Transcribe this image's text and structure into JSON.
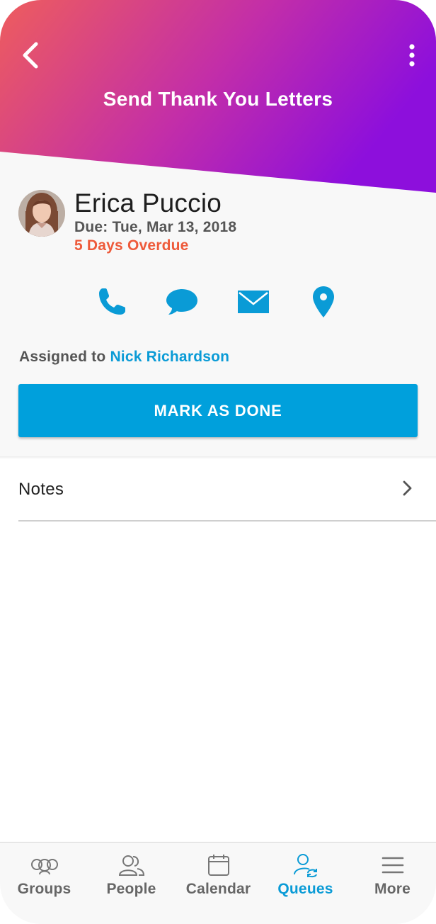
{
  "colors": {
    "gradient_start": "#ee5d5d",
    "gradient_mid": "#c32ea8",
    "gradient_end": "#8d0fdc",
    "accent": "#00a0dc",
    "overdue": "#ee5a3a",
    "icon_blue": "#0a9bd6"
  },
  "header": {
    "title": "Send Thank You Letters",
    "back_icon": "chevron-left-icon",
    "menu_icon": "kebab-menu-icon"
  },
  "person": {
    "name": "Erica Puccio",
    "due": "Due: Tue, Mar 13, 2018",
    "overdue": "5 Days Overdue"
  },
  "actions": [
    {
      "icon": "phone-icon"
    },
    {
      "icon": "chat-bubble-icon"
    },
    {
      "icon": "mail-icon"
    },
    {
      "icon": "location-pin-icon"
    }
  ],
  "assignment": {
    "prefix": "Assigned to",
    "assignee": "Nick Richardson"
  },
  "mark_done": {
    "label": "MARK AS DONE"
  },
  "notes": {
    "label": "Notes",
    "icon": "chevron-right-icon"
  },
  "tabbar": {
    "active": "Queues",
    "tabs": [
      {
        "label": "Groups",
        "icon": "groups-icon"
      },
      {
        "label": "People",
        "icon": "people-icon"
      },
      {
        "label": "Calendar",
        "icon": "calendar-icon"
      },
      {
        "label": "Queues",
        "icon": "queues-icon"
      },
      {
        "label": "More",
        "icon": "hamburger-icon"
      }
    ]
  }
}
